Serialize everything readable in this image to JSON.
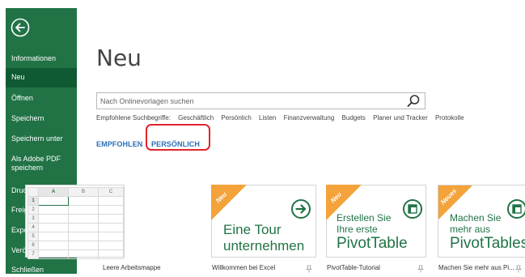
{
  "sidebar": {
    "items": [
      {
        "label": "Informationen",
        "active": false
      },
      {
        "label": "Neu",
        "active": true
      },
      {
        "label": "Öffnen",
        "active": false
      },
      {
        "label": "Speichern",
        "active": false
      },
      {
        "label": "Speichern unter",
        "active": false
      },
      {
        "label": "Als Adobe PDF speichern",
        "active": false
      },
      {
        "label": "Drucken",
        "active": false
      },
      {
        "label": "Freigeben",
        "active": false
      },
      {
        "label": "Exportieren",
        "active": false
      },
      {
        "label": "Veröffentlichen",
        "active": false
      },
      {
        "label": "Schließen",
        "active": false
      }
    ],
    "back_icon": "back-arrow-icon"
  },
  "page": {
    "title": "Neu"
  },
  "search": {
    "placeholder": "Nach Onlinevorlagen suchen",
    "icon": "search-icon"
  },
  "suggestions": {
    "label": "Empfohlene Suchbegriffe:",
    "items": [
      "Geschäftlich",
      "Persönlich",
      "Listen",
      "Finanzverwaltung",
      "Budgets",
      "Planer und Tracker",
      "Protokolle"
    ]
  },
  "tabs": {
    "featured": "EMPFOHLEN",
    "personal": "PERSÖNLICH"
  },
  "templates": [
    {
      "name": "Leere Arbeitsmappe",
      "kind": "blank"
    },
    {
      "name": "Willkommen bei Excel",
      "badge": "Neu",
      "line1": "Eine Tour",
      "line2": "unternehmen",
      "icon": "arrow-right-circle-icon"
    },
    {
      "name": "PivotTable-Tutorial",
      "badge": "Neu",
      "line1": "Erstellen Sie",
      "line2": "Ihre erste",
      "line3": "PivotTable",
      "icon": "pivot-icon"
    },
    {
      "name": "Machen Sie mehr aus Pi...",
      "badge": "Neues",
      "line1": "Machen Sie",
      "line2": "mehr aus",
      "line3": "PivotTables",
      "icon": "pivot-icon"
    }
  ],
  "sheet": {
    "columns": [
      "A",
      "B",
      "C"
    ],
    "rows": [
      "1",
      "2",
      "3",
      "4",
      "5",
      "6",
      "7"
    ]
  },
  "colors": {
    "excel_green": "#217346",
    "excel_green_dark": "#0f5a32",
    "link_blue": "#2b6fb8",
    "badge_orange": "#f4a23a",
    "highlight_red": "#e2242c"
  }
}
